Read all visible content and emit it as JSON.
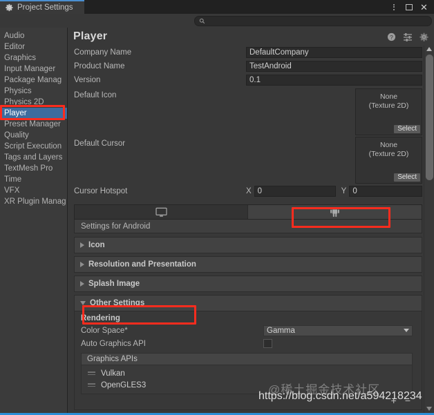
{
  "window": {
    "tab_title": "Project Settings",
    "tab_icon": "gear-icon",
    "titlebar_buttons": [
      "kebab-menu-icon",
      "maximize-icon",
      "close-icon"
    ],
    "accent_color": "#2b8fd8"
  },
  "search": {
    "value": "",
    "placeholder": "",
    "icon": "search-icon"
  },
  "sidebar": {
    "items": [
      {
        "label": "Audio",
        "selected": false
      },
      {
        "label": "Editor",
        "selected": false
      },
      {
        "label": "Graphics",
        "selected": false
      },
      {
        "label": "Input Manager",
        "selected": false
      },
      {
        "label": "Package Manag",
        "selected": false
      },
      {
        "label": "Physics",
        "selected": false
      },
      {
        "label": "Physics 2D",
        "selected": false
      },
      {
        "label": "Player",
        "selected": true
      },
      {
        "label": "Preset Manager",
        "selected": false
      },
      {
        "label": "Quality",
        "selected": false
      },
      {
        "label": "Script Execution",
        "selected": false
      },
      {
        "label": "Tags and Layers",
        "selected": false
      },
      {
        "label": "TextMesh Pro",
        "selected": false
      },
      {
        "label": "Time",
        "selected": false
      },
      {
        "label": "VFX",
        "selected": false
      },
      {
        "label": "XR Plugin Manag",
        "selected": false
      }
    ],
    "selected_color": "#3e6c9e"
  },
  "header": {
    "title": "Player",
    "icons": [
      "help-icon",
      "preset-icon",
      "gear-icon"
    ]
  },
  "fields": {
    "company_name": {
      "label": "Company Name",
      "value": "DefaultCompany"
    },
    "product_name": {
      "label": "Product Name",
      "value": "TestAndroid"
    },
    "version": {
      "label": "Version",
      "value": "0.1"
    },
    "default_icon": {
      "label": "Default Icon",
      "value_line1": "None",
      "value_line2": "(Texture 2D)",
      "select_label": "Select"
    },
    "default_cursor": {
      "label": "Default Cursor",
      "value_line1": "None",
      "value_line2": "(Texture 2D)",
      "select_label": "Select"
    },
    "cursor_hotspot": {
      "label": "Cursor Hotspot",
      "x_axis": "X",
      "x_value": "0",
      "y_axis": "Y",
      "y_value": "0"
    }
  },
  "platform_tabs": [
    {
      "icon": "monitor-icon",
      "name": "standalone",
      "active": false
    },
    {
      "icon": "android-icon",
      "name": "android",
      "active": true
    }
  ],
  "settings_for": "Settings for Android",
  "foldouts": [
    {
      "label": "Icon",
      "expanded": false
    },
    {
      "label": "Resolution and Presentation",
      "expanded": false
    },
    {
      "label": "Splash Image",
      "expanded": false
    },
    {
      "label": "Other Settings",
      "expanded": true
    }
  ],
  "other_settings": {
    "section_title": "Rendering",
    "color_space": {
      "label": "Color Space*",
      "value": "Gamma"
    },
    "auto_graphics_api": {
      "label": "Auto Graphics API",
      "checked": false
    },
    "graphics_apis": {
      "header": "Graphics APIs",
      "items": [
        "Vulkan",
        "OpenGLES3"
      ],
      "add_label": "+",
      "remove_label": "−"
    }
  },
  "scrollbar": {
    "position_pct": 8
  },
  "annotations": {
    "highlight_color": "#fb2c1e",
    "boxes": [
      "sidebar-player-item",
      "android-platform-tab",
      "other-settings-foldout"
    ]
  },
  "watermarks": {
    "chinese": "@稀土掘金技术社区",
    "url": "https://blog.csdn.net/a594218234"
  }
}
